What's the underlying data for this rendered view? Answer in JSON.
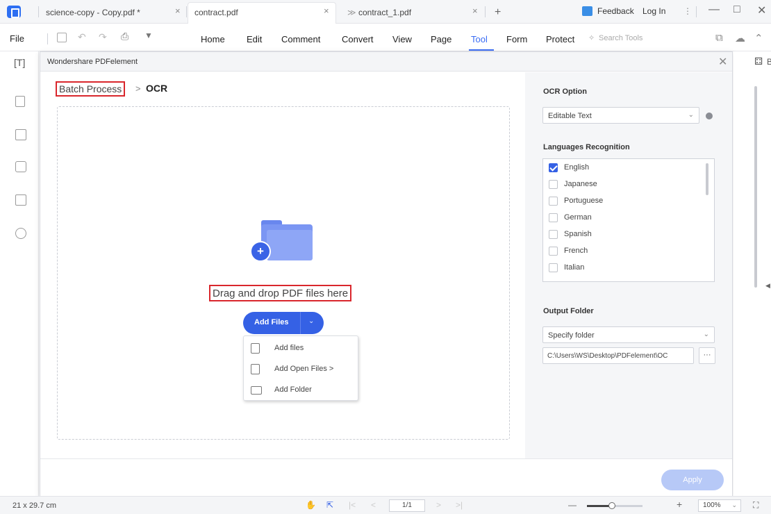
{
  "tabs": [
    {
      "label": "science-copy - Copy.pdf *",
      "close": "×"
    },
    {
      "label": "contract.pdf",
      "close": "×"
    },
    {
      "label": "contract_1.pdf",
      "close": "×"
    }
  ],
  "new_tab": "+",
  "titlebar": {
    "feedback": "Feedback",
    "login": "Log In",
    "more": "⋮",
    "minimize": "—",
    "restore": "□",
    "close": "✕"
  },
  "menu": {
    "file": "File",
    "items": [
      "Home",
      "Edit",
      "Comment",
      "Convert",
      "View",
      "Page",
      "Tool",
      "Form",
      "Protect"
    ],
    "active": "Tool",
    "search_placeholder": "Search Tools"
  },
  "dialog": {
    "title": "Wondershare PDFelement",
    "close": "✕",
    "breadcrumb_parent": "Batch Process",
    "breadcrumb_sep": ">",
    "breadcrumb_current": "OCR",
    "drop_text": "Drag and drop PDF files here",
    "add_button": "Add Files",
    "add_menu": [
      "Add files",
      "Add Open Files >",
      "Add Folder"
    ],
    "apply": "Apply"
  },
  "ocr_panel": {
    "ocr_option_heading": "OCR Option",
    "ocr_option_value": "Editable Text",
    "languages_heading": "Languages Recognition",
    "languages": [
      {
        "label": "English",
        "checked": true
      },
      {
        "label": "Japanese",
        "checked": false
      },
      {
        "label": "Portuguese",
        "checked": false
      },
      {
        "label": "German",
        "checked": false
      },
      {
        "label": "Spanish",
        "checked": false
      },
      {
        "label": "French",
        "checked": false
      },
      {
        "label": "Italian",
        "checked": false
      }
    ],
    "output_heading": "Output Folder",
    "output_value": "Specify folder",
    "output_path": "C:\\Users\\WS\\Desktop\\PDFelement\\OC",
    "browse": "···"
  },
  "right_strip": {
    "label": "Ba"
  },
  "statusbar": {
    "page_size": "21 x 29.7 cm",
    "page_indicator": "1/1",
    "zoom": "100%",
    "zoom_fraction": 0.45
  },
  "colors": {
    "accent": "#3561e5",
    "highlight_box": "#d9262c",
    "apply_disabled": "#b7c9f7"
  }
}
